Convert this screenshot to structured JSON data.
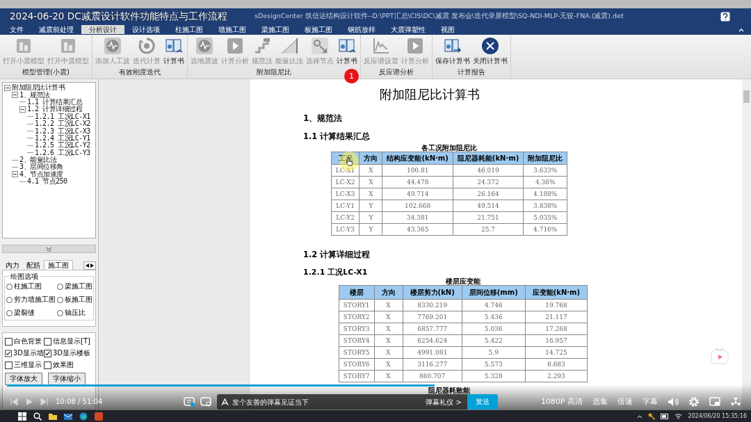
{
  "video_title": "2024-06-20 DC减震设计软件功能特点与工作流程",
  "window": {
    "title": "sDesignCenter 筑信达结构设计软件--D:\\PPT汇总\\CIS\\DC\\减震 发布会\\迭代录屏模型\\SQ-NDI-MLP-无较-FNA.(减震).det"
  },
  "menu": [
    {
      "label": "文件",
      "selected": false
    },
    {
      "label": "减震前处理",
      "selected": false
    },
    {
      "label": "分析设计",
      "selected": true
    },
    {
      "label": "设计选项",
      "selected": false
    },
    {
      "label": "柱施工图",
      "selected": false
    },
    {
      "label": "墙施工图",
      "selected": false
    },
    {
      "label": "梁施工图",
      "selected": false
    },
    {
      "label": "板施工图",
      "selected": false
    },
    {
      "label": "钢筋放样",
      "selected": false
    },
    {
      "label": "大震弹塑性",
      "selected": false
    },
    {
      "label": "视图",
      "selected": false
    }
  ],
  "ribbon": [
    {
      "label": "模型管理(小震)",
      "buttons": [
        {
          "label": "打开小震模型",
          "kind": "building",
          "disabled": true
        },
        {
          "label": "打开中震模型",
          "kind": "building",
          "disabled": true
        }
      ]
    },
    {
      "label": "有效刚度迭代",
      "buttons": [
        {
          "label": "添加人工波",
          "kind": "wave",
          "disabled": true
        },
        {
          "label": "迭代计算",
          "kind": "cycle",
          "disabled": true
        },
        {
          "label": "计算书",
          "kind": "book",
          "disabled": false
        }
      ]
    },
    {
      "label": "附加阻尼比",
      "buttons": [
        {
          "label": "选地震波",
          "kind": "wave",
          "disabled": true
        },
        {
          "label": "计算分析",
          "kind": "play",
          "disabled": true
        },
        {
          "label": "规范法",
          "kind": "stairs",
          "disabled": true
        },
        {
          "label": "能量比法",
          "kind": "chart",
          "disabled": true
        },
        {
          "label": "选择节点",
          "kind": "node",
          "disabled": true
        },
        {
          "label": "计算书",
          "kind": "book",
          "disabled": false
        }
      ]
    },
    {
      "label": "反应谱分析",
      "buttons": [
        {
          "label": "反应谱设置",
          "kind": "spectrum",
          "disabled": true
        },
        {
          "label": "计算分析",
          "kind": "play",
          "disabled": true
        }
      ]
    },
    {
      "label": "计算报告",
      "buttons": [
        {
          "label": "保存计算书",
          "kind": "save",
          "disabled": false
        },
        {
          "label": "关闭计算书",
          "kind": "close",
          "disabled": false
        }
      ]
    }
  ],
  "step_badge": "1",
  "tree": [
    {
      "label": "附加阻尼比计算书",
      "expanded": true,
      "children": [
        {
          "label": "1、规范法",
          "expanded": true,
          "children": [
            {
              "label": "1.1 计算结果汇总"
            },
            {
              "label": "1.2 计算详细过程",
              "expanded": true,
              "children": [
                {
                  "label": "1.2.1 工况LC-X1"
                },
                {
                  "label": "1.2.2 工况LC-X2"
                },
                {
                  "label": "1.2.3 工况LC-X3"
                },
                {
                  "label": "1.2.4 工况LC-Y1"
                },
                {
                  "label": "1.2.5 工况LC-Y2"
                },
                {
                  "label": "1.2.6 工况LC-Y3"
                }
              ]
            }
          ]
        },
        {
          "label": "2、能量比法"
        },
        {
          "label": "3、层间位移角"
        },
        {
          "label": "4、节点加速度",
          "expanded": true,
          "children": [
            {
              "label": "4.1 节点250"
            }
          ]
        }
      ]
    }
  ],
  "panel_tabs": [
    {
      "label": "内力",
      "selected": false
    },
    {
      "label": "配筋",
      "selected": false
    },
    {
      "label": "施工图",
      "selected": true
    }
  ],
  "drawing_options": {
    "title": "绘图选项",
    "options": [
      {
        "label": "柱施工图",
        "selected": false
      },
      {
        "label": "梁施工图",
        "selected": false
      },
      {
        "label": "剪力墙施工图",
        "selected": false
      },
      {
        "label": "板施工图",
        "selected": false
      },
      {
        "label": "梁裂缝",
        "selected": false
      },
      {
        "label": "轴压比",
        "selected": false
      }
    ]
  },
  "display_options": [
    {
      "label": "白色背景",
      "checked": false
    },
    {
      "label": "信息显示[T]",
      "checked": false
    },
    {
      "label": "3D显示墙",
      "checked": true
    },
    {
      "label": "3D显示楼板",
      "checked": true
    },
    {
      "label": "三维显示",
      "checked": false
    },
    {
      "label": "效果图",
      "checked": false
    }
  ],
  "font_buttons": [
    "字体放大",
    "字体缩小"
  ],
  "document": {
    "title": "附加阻尼比计算书",
    "sections": [
      {
        "kind": "h1",
        "text": "1、规范法"
      },
      {
        "kind": "h2",
        "text": "1.1 计算结果汇总"
      },
      {
        "kind": "table",
        "caption": "各工况附加阻尼比",
        "columns": [
          "工况",
          "方向",
          "结构应变能(kN·m)",
          "阻尼器耗能(kN·m)",
          "附加阻尼比"
        ],
        "rows": [
          [
            "LC-X1",
            "X",
            "100.81",
            "46.019",
            "3.633%"
          ],
          [
            "LC-X2",
            "X",
            "44.478",
            "24.372",
            "4.36%"
          ],
          [
            "LC-X3",
            "X",
            "49.714",
            "26.164",
            "4.188%"
          ],
          [
            "LC-Y1",
            "Y",
            "102.668",
            "49.514",
            "3.838%"
          ],
          [
            "LC-Y2",
            "Y",
            "34.381",
            "21.751",
            "5.035%"
          ],
          [
            "LC-Y3",
            "Y",
            "43.365",
            "25.7",
            "4.716%"
          ]
        ]
      },
      {
        "kind": "h2",
        "text": "1.2 计算详细过程"
      },
      {
        "kind": "h3",
        "text": "1.2.1 工况LC-X1"
      },
      {
        "kind": "table",
        "caption": "楼层应变能",
        "columns": [
          "楼层",
          "方向",
          "楼层剪力(kN)",
          "层间位移(mm)",
          "应变能(kN·m)"
        ],
        "rows": [
          [
            "STORY1",
            "X",
            "8330.219",
            "4.746",
            "19.768"
          ],
          [
            "STORY2",
            "X",
            "7769.201",
            "5.436",
            "21.117"
          ],
          [
            "STORY3",
            "X",
            "6857.777",
            "5.036",
            "17.268"
          ],
          [
            "STORY4",
            "X",
            "6254.624",
            "5.422",
            "16.957"
          ],
          [
            "STORY5",
            "X",
            "4991.081",
            "5.9",
            "14.725"
          ],
          [
            "STORY6",
            "X",
            "3116.277",
            "5.573",
            "8.683"
          ],
          [
            "STORY7",
            "X",
            "860.707",
            "5.328",
            "2.293"
          ]
        ]
      },
      {
        "kind": "partial_table",
        "caption": "阻尼器耗散能"
      }
    ]
  },
  "player": {
    "progress": {
      "level": 0.58
    },
    "time": "10:08 / 51:04",
    "danmaku": {
      "placeholder": "发个友善的弹幕见证当下",
      "etiquette": "弹幕礼仪 >",
      "send": "发送"
    },
    "buttons": [
      "1080P 高清",
      "选集",
      "倍速",
      "字幕"
    ]
  },
  "taskbar": {
    "clock": "2024/06/20 15:35:16"
  }
}
